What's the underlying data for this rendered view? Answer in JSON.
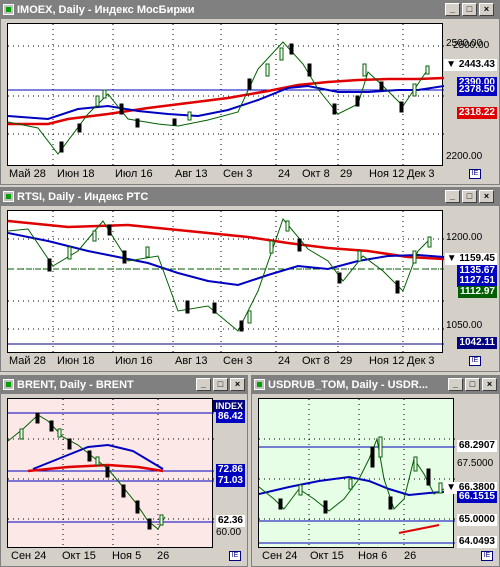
{
  "windows": {
    "imoex": {
      "title": "IMOEX, Daily - Индекс МосБиржи",
      "x_labels": [
        "Май 28",
        "Июн 18",
        "Июл 16",
        "Авг 13",
        "Сен 3",
        "24",
        "Окт 8",
        "29",
        "Ноя 12",
        "Дек 3"
      ],
      "y_labels": [
        "2500.00",
        "2200.00"
      ],
      "tags": {
        "last": "2443.43",
        "ma1": "2378.50",
        "ma2": "2318.22"
      },
      "hidden_tag": "2390.00"
    },
    "rtsi": {
      "title": "RTSI, Daily - Индекс РТС",
      "x_labels": [
        "Май 28",
        "Июн 18",
        "Июл 16",
        "Авг 13",
        "Сен 3",
        "24",
        "Окт 8",
        "29",
        "Ноя 12",
        "Дек 3"
      ],
      "y_labels": [
        "1200.00",
        "1050.00"
      ],
      "tags": {
        "last": "1159.45",
        "ma1": "1135.67",
        "ma2": "1127.51",
        "ma3": "1112.97",
        "low": "1042.11"
      }
    },
    "brent": {
      "title": "BRENT, Daily - BRENT",
      "header_label": "INDEX",
      "x_labels": [
        "Сен 24",
        "Окт 15",
        "Ноя 5",
        "26"
      ],
      "tags": {
        "t1": "86.42",
        "t2": "72.86",
        "t3": "71.03",
        "t4": "62.36",
        "t5": "60.00"
      }
    },
    "usdrub": {
      "title": "USDRUB_TOM, Daily - USDR...",
      "x_labels": [
        "Сен 24",
        "Окт 15",
        "Ноя 6",
        "26"
      ],
      "y_labels": [
        "67.5000"
      ],
      "tags": {
        "t1": "68.2907",
        "t2": "66.3800",
        "t3": "66.1515",
        "t4": "65.0000",
        "t5": "64.0493"
      }
    }
  },
  "colors": {
    "ma_red": "#e00000",
    "ma_blue": "#0000c0",
    "up": "#ffffff",
    "down": "#000000",
    "wick": "#006000",
    "tag_bg": "#000000",
    "tag_fg": "#ffffff"
  }
}
